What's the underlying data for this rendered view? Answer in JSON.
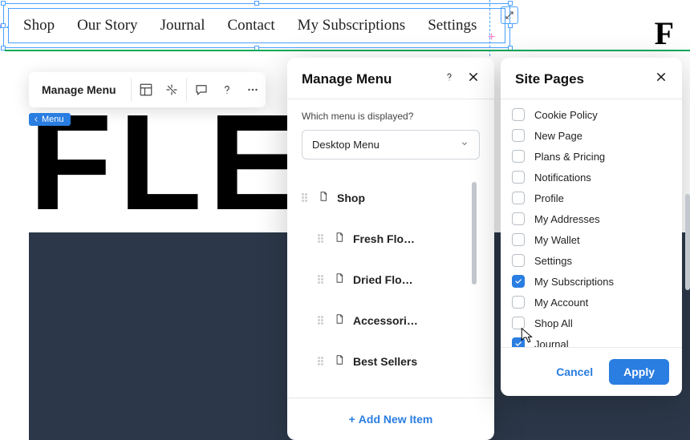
{
  "top_nav": {
    "items": [
      "Shop",
      "Our Story",
      "Journal",
      "Contact",
      "My Subscriptions",
      "Settings"
    ],
    "logo": "F"
  },
  "toolbar": {
    "main_label": "Manage Menu",
    "icons": [
      "layout-icon",
      "align-icon",
      "comment-icon",
      "help-icon",
      "more-icon"
    ]
  },
  "menu_chip": "Menu",
  "bg_text": "FLE",
  "manage_panel": {
    "title": "Manage Menu",
    "which_label": "Which menu is displayed?",
    "select_value": "Desktop Menu",
    "items": [
      {
        "label": "Shop",
        "level": 0
      },
      {
        "label": "Fresh Flo…",
        "level": 1
      },
      {
        "label": "Dried Flo…",
        "level": 1
      },
      {
        "label": "Accessori…",
        "level": 1
      },
      {
        "label": "Best Sellers",
        "level": 1
      }
    ],
    "add_label": "Add New Item"
  },
  "site_pages": {
    "title": "Site Pages",
    "rows": [
      {
        "label": "Cookie Policy",
        "checked": false
      },
      {
        "label": "New Page",
        "checked": false
      },
      {
        "label": "Plans & Pricing",
        "checked": false
      },
      {
        "label": "Notifications",
        "checked": false
      },
      {
        "label": "Profile",
        "checked": false
      },
      {
        "label": "My Addresses",
        "checked": false
      },
      {
        "label": "My Wallet",
        "checked": false
      },
      {
        "label": "Settings",
        "checked": false
      },
      {
        "label": "My Subscriptions",
        "checked": true
      },
      {
        "label": "My Account",
        "checked": false
      },
      {
        "label": "Shop All",
        "checked": false
      },
      {
        "label": "Journal",
        "checked": true
      }
    ],
    "cancel": "Cancel",
    "apply": "Apply"
  }
}
